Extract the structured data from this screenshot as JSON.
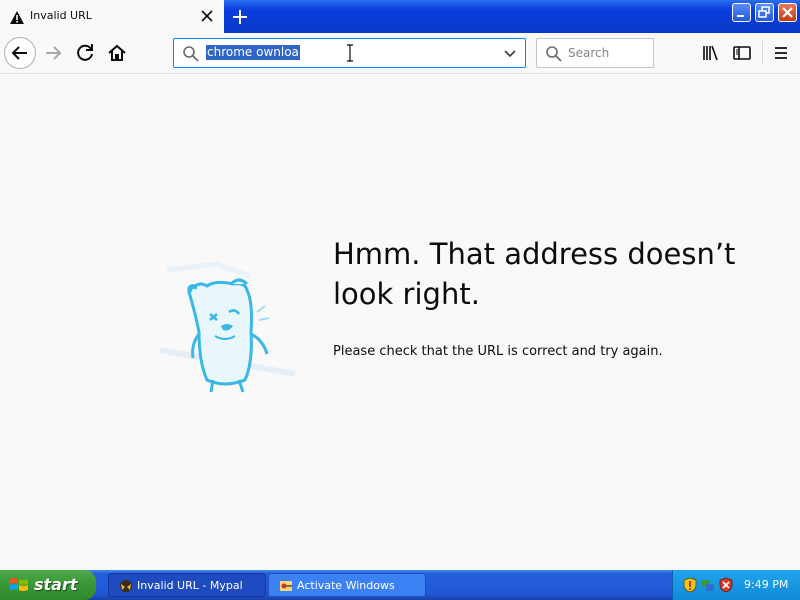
{
  "tab": {
    "title": "Invalid URL",
    "icon": "warning-icon"
  },
  "nav": {
    "url_value": "chrome ownloa",
    "search_placeholder": "Search"
  },
  "error": {
    "headline": "Hmm. That address doesn’t look right.",
    "message": "Please check that the URL is correct and try again."
  },
  "taskbar": {
    "start_label": "start",
    "items": [
      {
        "label": "Invalid URL - Mypal",
        "active": true
      },
      {
        "label": "Activate Windows",
        "active": false
      }
    ],
    "clock": "9:49 PM"
  },
  "colors": {
    "title_bar": "#0a3fdc",
    "urlbar_focus": "#0a84ff",
    "selection": "#3064c8",
    "taskbar": "#245edb",
    "start_button": "#3c9a39"
  }
}
